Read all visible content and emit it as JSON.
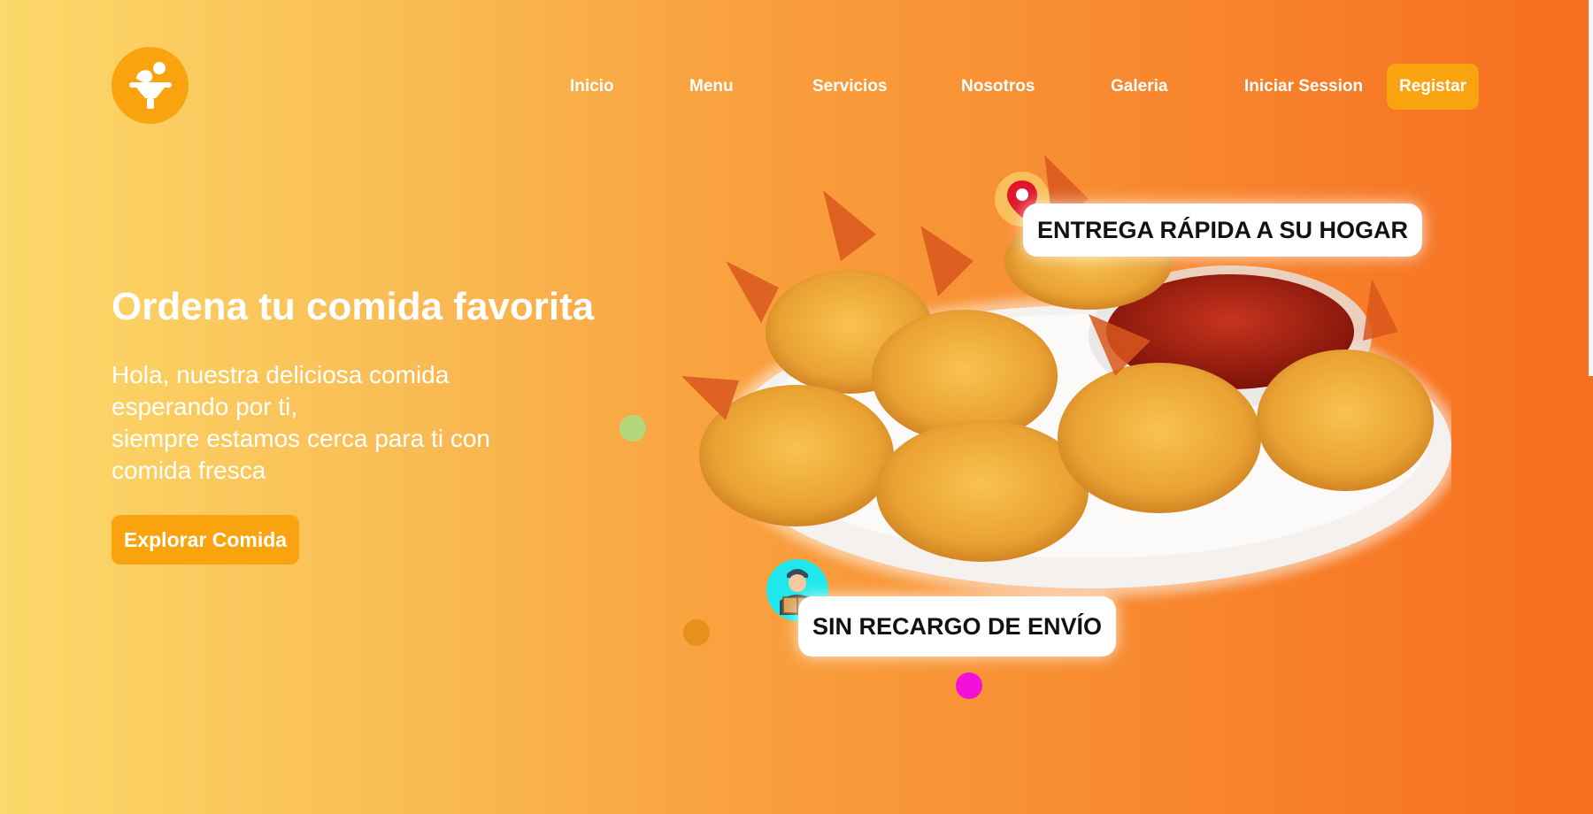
{
  "brand": {
    "logo_icon": "dish-person-icon",
    "color": "#f9a30f"
  },
  "nav": {
    "items": [
      "Inicio",
      "Menu",
      "Servicios",
      "Nosotros",
      "Galeria",
      "Iniciar Session"
    ],
    "register": "Registar"
  },
  "hero": {
    "title": "Ordena tu comida favorita",
    "subtitle_lines": [
      "Hola, nuestra deliciosa comida",
      "esperando por ti,",
      "siempre estamos cerca para ti con",
      "comida fresca"
    ],
    "cta": "Explorar Comida"
  },
  "badges": {
    "delivery": "ENTREGA RÁPIDA A SU HOGAR",
    "shipping": "SIN RECARGO DE ENVÍO"
  },
  "colors": {
    "gradient_left": "#fcd96a",
    "gradient_right": "#f66e20",
    "dot_green": "#b4d77c",
    "dot_orange": "#e8901c",
    "dot_magenta": "#f20fd8",
    "pin": "#e0162b",
    "courier_bg": "#1ee8ec"
  }
}
